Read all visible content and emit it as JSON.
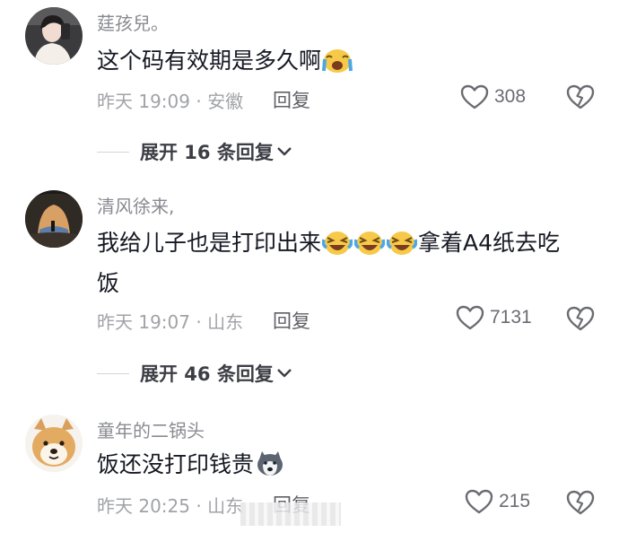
{
  "comments": [
    {
      "username": "莛孩兒。",
      "text_before": "这个码有效期是多久啊",
      "text_after": "",
      "emoji": "crying-face-emoji",
      "time_location": "昨天 19:09 · 安徽",
      "reply_label": "回复",
      "likes": "308",
      "expand_label": "展开 16 条回复"
    },
    {
      "username": "清风徐来,",
      "text_before": "我给儿子也是打印出来",
      "text_after": "拿着A4纸去吃饭",
      "emoji": "laughing-crying-emoji",
      "time_location": "昨天 19:07 · 山东",
      "reply_label": "回复",
      "likes": "7131",
      "expand_label": "展开 46 条回复"
    },
    {
      "username": "童年的二锅头",
      "text_before": "饭还没打印钱贵",
      "text_after": "",
      "emoji": "husky-emoji",
      "time_location": "昨天 20:25 · 山东",
      "reply_label": "回复",
      "likes": "215"
    }
  ],
  "colors": {
    "text": "#161823",
    "secondary": "#8a8b91",
    "meta": "#a2a3a7",
    "icon": "#6b6c72"
  }
}
